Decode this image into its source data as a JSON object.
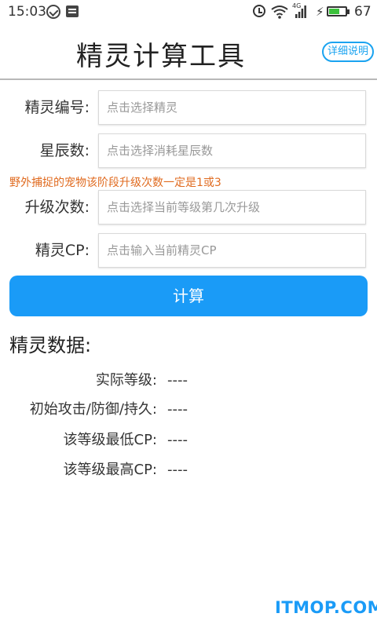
{
  "status_bar": {
    "time": "15:03",
    "network": "4G",
    "battery_level": "67",
    "battery_fill_fraction": 0.67,
    "battery_color": "#3cc13c"
  },
  "header": {
    "title": "精灵计算工具",
    "help_label": "详细说明"
  },
  "form": {
    "fields": [
      {
        "label": "精灵编号:",
        "placeholder": "点击选择精灵"
      },
      {
        "label": "星辰数:",
        "placeholder": "点击选择消耗星辰数"
      },
      {
        "label": "升级次数:",
        "placeholder": "点击选择当前等级第几次升级"
      },
      {
        "label": "精灵CP:",
        "placeholder": "点击输入当前精灵CP"
      }
    ],
    "warning": "野外捕捉的宠物该阶段升级次数一定是1或3",
    "calculate_label": "计算"
  },
  "results": {
    "title": "精灵数据:",
    "rows": [
      {
        "label": "实际等级:",
        "value": "----"
      },
      {
        "label": "初始攻击/防御/持久:",
        "value": "----"
      },
      {
        "label": "该等级最低CP:",
        "value": "----"
      },
      {
        "label": "该等级最高CP:",
        "value": "----"
      }
    ]
  },
  "watermark": "ITMOP.COM",
  "colors": {
    "accent": "#1a9bf7",
    "warning": "#e06b20",
    "help_border": "#1aa3f0"
  },
  "icons": [
    "check-circle-icon",
    "card-icon",
    "alarm-icon",
    "wifi-icon",
    "signal-icon",
    "charging-icon",
    "battery-icon"
  ]
}
